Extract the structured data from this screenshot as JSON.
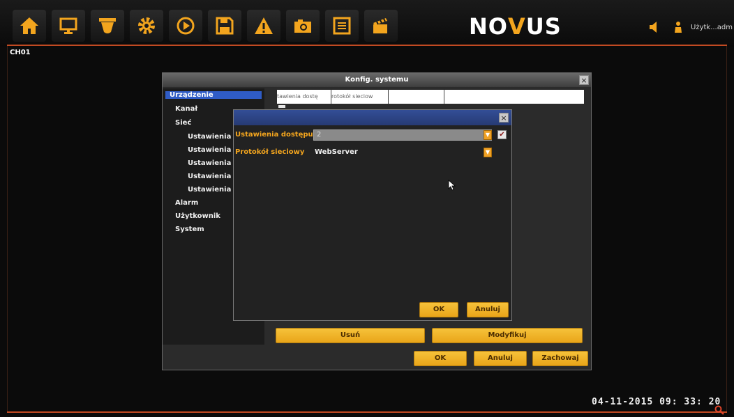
{
  "toolbar": {
    "icons": [
      "home-icon",
      "monitor-icon",
      "ptz-camera-icon",
      "settings-gear-icon",
      "playback-icon",
      "save-disk-icon",
      "alarm-warning-icon",
      "snapshot-camera-icon",
      "log-list-icon",
      "clapperboard-icon"
    ],
    "accent_color": "#f3a51e",
    "line_color": "#c24a22"
  },
  "header": {
    "logo_left": "NO",
    "logo_v": "V",
    "logo_right": "US",
    "user": "Użytk...adm"
  },
  "channel_label": "CH01",
  "datetime": "04-11-2015 09: 33: 20",
  "config_dialog": {
    "title": "Konfig. systemu",
    "close": "×",
    "tree": [
      {
        "label": "Urządzenie",
        "selected": true,
        "level": 0
      },
      {
        "label": "Kanał",
        "level": 0
      },
      {
        "label": "Sieć",
        "level": 0
      },
      {
        "label": "Ustawienia I",
        "level": 1
      },
      {
        "label": "Ustawienia I",
        "level": 1
      },
      {
        "label": "Ustawienia I",
        "level": 1
      },
      {
        "label": "Ustawienia I",
        "level": 1
      },
      {
        "label": "Ustawienia c",
        "level": 1
      },
      {
        "label": "Alarm",
        "level": 0
      },
      {
        "label": "Użytkownik",
        "level": 0
      },
      {
        "label": "System",
        "level": 0
      }
    ],
    "tabs": [
      "tawienia dostę",
      "rotokół sieciow",
      "",
      ""
    ],
    "buttons": {
      "delete": "Usuń",
      "modify": "Modyfikuj",
      "ok": "OK",
      "cancel": "Anuluj",
      "save": "Zachowaj"
    }
  },
  "access_dialog": {
    "close": "×",
    "access_label": "Ustawienia dostępu",
    "access_value": "2",
    "access_checked": "✔",
    "protocol_label": "Protokół sieciowy",
    "protocol_value": "WebServer",
    "dropdown_glyph": "▼",
    "ok": "OK",
    "cancel": "Anuluj"
  }
}
